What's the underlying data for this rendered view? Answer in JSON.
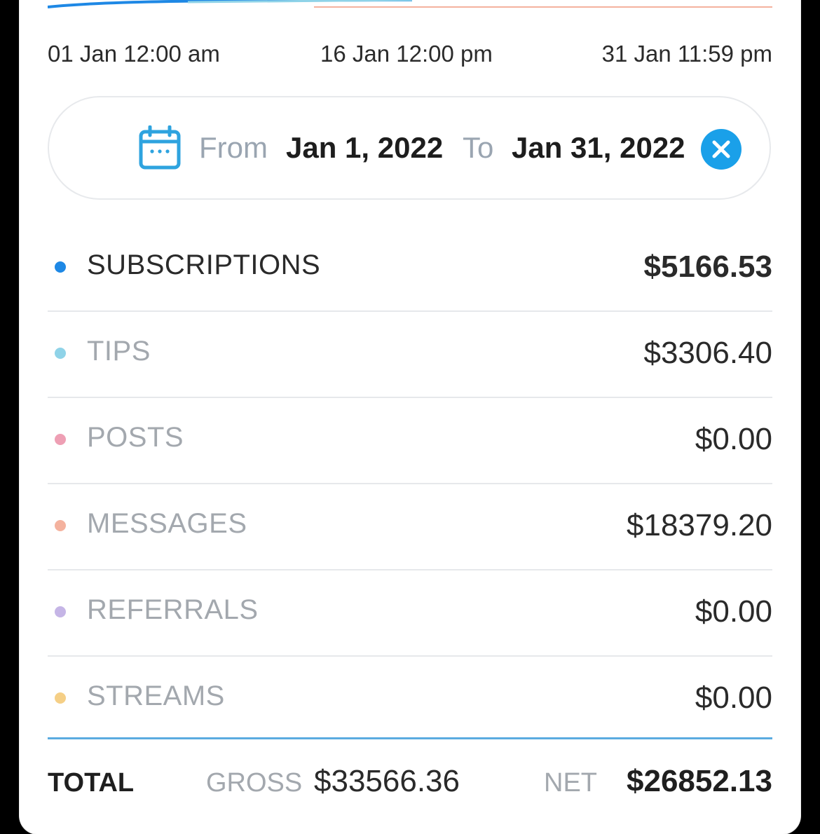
{
  "axis": {
    "start": "01 Jan 12:00 am",
    "middle": "16 Jan 12:00 pm",
    "end": "31 Jan 11:59 pm"
  },
  "date_range": {
    "from_label": "From",
    "from_date": "Jan 1, 2022",
    "to_label": "To",
    "to_date": "Jan 31, 2022",
    "icon": "calendar-icon",
    "clear_icon": "close-icon",
    "accent_color": "#1aa0e9"
  },
  "categories": [
    {
      "label": "SUBSCRIPTIONS",
      "value": "$5166.53",
      "color": "#1e88e5",
      "primary": true
    },
    {
      "label": "TIPS",
      "value": "$3306.40",
      "color": "#8fd3e8",
      "primary": false
    },
    {
      "label": "POSTS",
      "value": "$0.00",
      "color": "#ee9fb4",
      "primary": false
    },
    {
      "label": "MESSAGES",
      "value": "$18379.20",
      "color": "#f4b29e",
      "primary": false
    },
    {
      "label": "REFERRALS",
      "value": "$0.00",
      "color": "#c5b5e6",
      "primary": false
    },
    {
      "label": "STREAMS",
      "value": "$0.00",
      "color": "#f5cf86",
      "primary": false
    }
  ],
  "total": {
    "label": "TOTAL",
    "gross_label": "GROSS",
    "gross_value": "$33566.36",
    "net_label": "NET",
    "net_value": "$26852.13"
  }
}
